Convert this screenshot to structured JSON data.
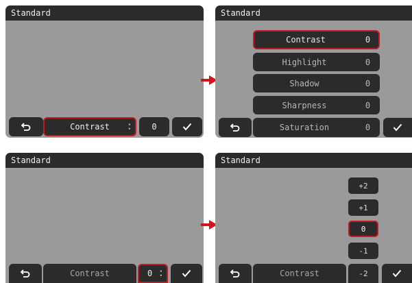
{
  "colors": {
    "screen_bg": "#9a9a9a",
    "bar_bg": "#2b2b2b",
    "selection": "#c21a21",
    "arrow": "#d2141e"
  },
  "panel1": {
    "title": "Standard",
    "selector_label": "Contrast",
    "value": "0"
  },
  "panel2": {
    "title": "Standard",
    "items": [
      {
        "label": "Contrast",
        "value": "0"
      },
      {
        "label": "Highlight",
        "value": "0"
      },
      {
        "label": "Shadow",
        "value": "0"
      },
      {
        "label": "Sharpness",
        "value": "0"
      },
      {
        "label": "Saturation",
        "value": "0"
      }
    ]
  },
  "panel3": {
    "title": "Standard",
    "selector_label": "Contrast",
    "value": "0"
  },
  "panel4": {
    "title": "Standard",
    "selector_label": "Contrast",
    "scale": [
      "+2",
      "+1",
      "0",
      "-1",
      "-2"
    ]
  },
  "icons": {
    "back": "back-arrow-icon",
    "confirm": "checkmark-icon",
    "updown": "up-down-chevron-icon",
    "transition": "red-arrow-icon"
  }
}
